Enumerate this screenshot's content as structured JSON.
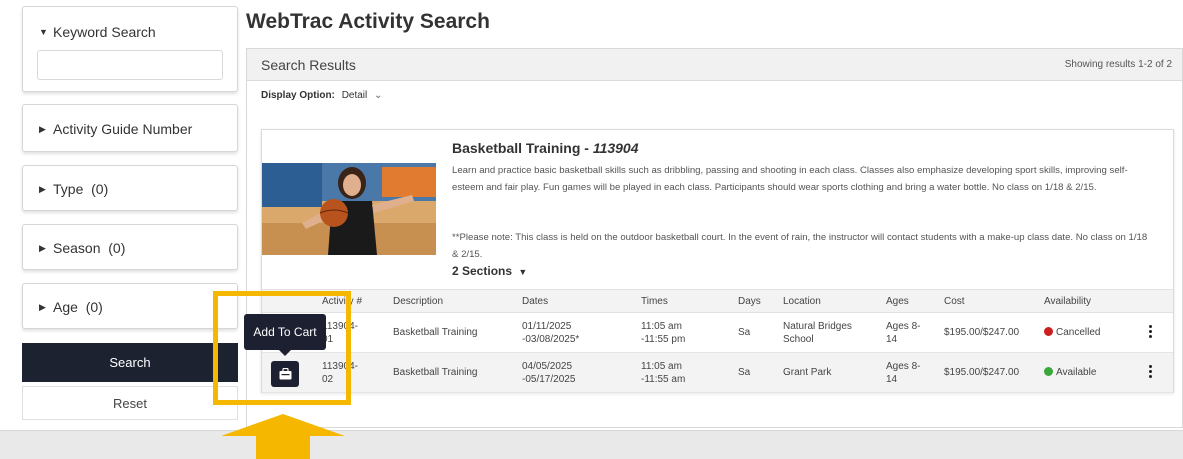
{
  "sidebar": {
    "keyword_search": {
      "label": "Keyword Search",
      "value": ""
    },
    "filters": [
      {
        "label": "Activity Guide Number"
      },
      {
        "label": "Type  (0)"
      },
      {
        "label": "Season  (0)"
      },
      {
        "label": "Age  (0)"
      }
    ],
    "search_label": "Search",
    "reset_label": "Reset"
  },
  "main": {
    "page_title": "WebTrac Activity Search",
    "results_title": "Search Results",
    "results_count": "Showing results 1-2 of 2",
    "display_option_label": "Display Option:",
    "display_option_value": "Detail"
  },
  "activity": {
    "name": "Basketball Training - ",
    "number": "113904",
    "description": "Learn and practice basic basketball skills such as dribbling, passing and shooting in each class. Classes also emphasize developing sport skills, improving self-esteem and fair play. Fun games will be played in each class. Participants should wear sports clothing and bring a water bottle. No class on 1/18 & 2/15.",
    "note": "**Please note: This class is held on the outdoor basketball court. In the event of rain, the instructor will contact students with a make-up class date. No class on 1/18 & 2/15.",
    "sections_label": "2 Sections"
  },
  "table": {
    "headers": {
      "activity": "Activity #",
      "description": "Description",
      "dates": "Dates",
      "times": "Times",
      "days": "Days",
      "location": "Location",
      "ages": "Ages",
      "cost": "Cost",
      "availability": "Availability"
    },
    "rows": [
      {
        "activity_line1": "113904-",
        "activity_line2": "01",
        "description": "Basketball Training",
        "dates_line1": "01/11/2025",
        "dates_line2": "-03/08/2025*",
        "times_line1": "11:05 am",
        "times_line2": "-11:55 pm",
        "days": "Sa",
        "location_line1": "Natural Bridges",
        "location_line2": "School",
        "ages_line1": "Ages 8-",
        "ages_line2": "14",
        "cost": "$195.00/$247.00",
        "availability": "Cancelled",
        "status_color": "#cc1f1f"
      },
      {
        "activity_line1": "113904-",
        "activity_line2": "02",
        "description": "Basketball Training",
        "dates_line1": "04/05/2025",
        "dates_line2": "-05/17/2025",
        "times_line1": "11:05 am",
        "times_line2": "-11:55 am",
        "days": "Sa",
        "location_line1": "Grant Park",
        "location_line2": "",
        "ages_line1": "Ages 8-",
        "ages_line2": "14",
        "cost": "$195.00/$247.00",
        "availability": "Available",
        "status_color": "#3aa83a"
      }
    ]
  },
  "overlay": {
    "tooltip": "Add To Cart",
    "highlight_color": "#f6b700"
  }
}
